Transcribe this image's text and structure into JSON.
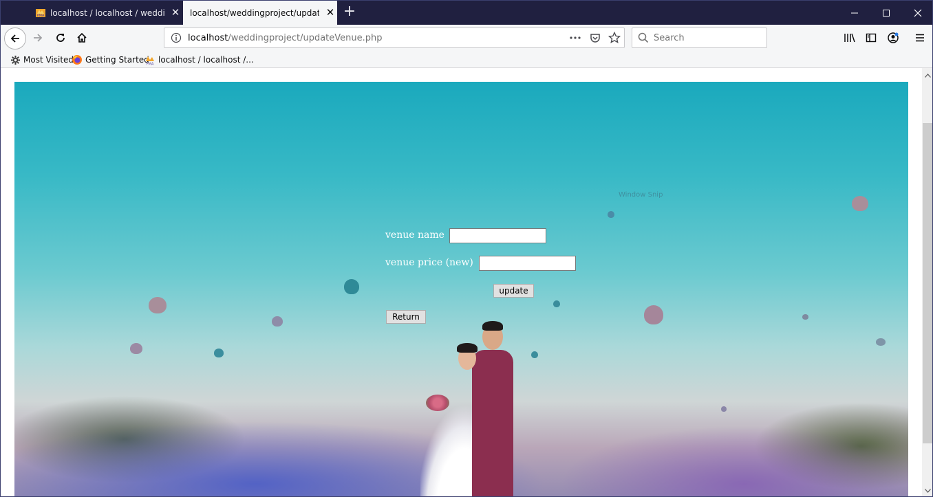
{
  "tabs": [
    {
      "title": "localhost / localhost / weddingproject / venue | phpMyAdmin",
      "active": false,
      "icon": "phpmyadmin-icon"
    },
    {
      "title": "localhost/weddingproject/updateVenue.php",
      "active": true,
      "icon": "none"
    }
  ],
  "toolbar": {
    "url_host": "localhost",
    "url_path": "/weddingproject/updateVenue.php",
    "search_placeholder": "Search"
  },
  "bookmarks": [
    {
      "label": "Most Visited",
      "icon": "gear-icon"
    },
    {
      "label": "Getting Started",
      "icon": "firefox-icon"
    },
    {
      "label": "localhost / localhost /...",
      "icon": "phpmyadmin-icon"
    }
  ],
  "page": {
    "overlay_text": "Window Snip",
    "form": {
      "venue_name_label": "venue name",
      "venue_name_value": "",
      "venue_price_label": "venue price (new)",
      "venue_price_value": "",
      "update_label": "update",
      "return_label": "Return"
    }
  },
  "colors": {
    "tabbar": "#202040",
    "toolbar": "#f5f6f7",
    "suit": "#8b2e4f"
  }
}
